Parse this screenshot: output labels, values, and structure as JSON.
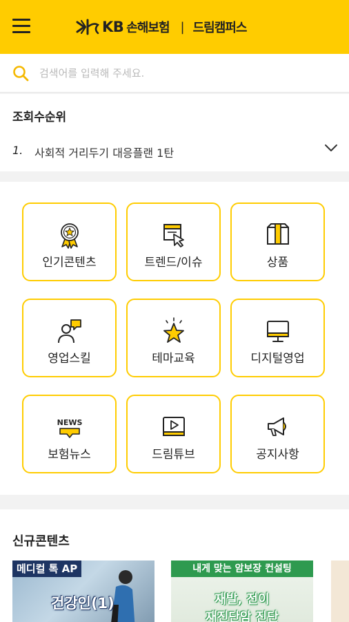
{
  "header": {
    "brand_mark": "KB",
    "brand_name": "손해보험",
    "separator": "|",
    "service_name": "드림캠퍼스",
    "accent_color": "#ffcc00"
  },
  "search": {
    "placeholder": "검색어를 입력해 주세요.",
    "icon": "search-icon"
  },
  "ranking": {
    "title": "조회수순위",
    "items": [
      {
        "rank": "1.",
        "text": "사회적 거리두기 대응플랜 1탄"
      }
    ]
  },
  "menu": {
    "items": [
      {
        "label": "인기콘텐츠",
        "icon": "award-medal-icon"
      },
      {
        "label": "트렌드/이슈",
        "icon": "cursor-window-icon"
      },
      {
        "label": "상품",
        "icon": "package-box-icon"
      },
      {
        "label": "영업스킬",
        "icon": "person-chat-icon"
      },
      {
        "label": "테마교육",
        "icon": "star-icon"
      },
      {
        "label": "디지털영업",
        "icon": "monitor-icon"
      },
      {
        "label": "보험뉴스",
        "icon": "news-bubble-icon",
        "icon_text": "NEWS"
      },
      {
        "label": "드림튜브",
        "icon": "video-play-icon"
      },
      {
        "label": "공지사항",
        "icon": "megaphone-icon"
      }
    ]
  },
  "new_contents": {
    "title": "신규콘텐츠",
    "cards": [
      {
        "tag": "메디컬 톡 AP",
        "headline": "건강인(1)"
      },
      {
        "tag": "내게 맞는 암보장 컨설팅",
        "headline_line1": "재발, 전이",
        "headline_line2": "재진단암 진단"
      }
    ]
  }
}
